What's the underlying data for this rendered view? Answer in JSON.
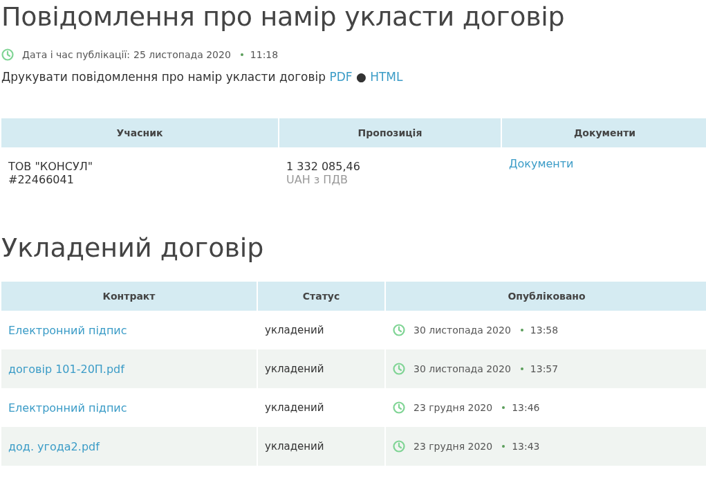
{
  "title": "Повідомлення про намір укласти договір",
  "publication": {
    "label": "Дата і час публікації:",
    "date": "25 листопада 2020",
    "time": "11:18"
  },
  "print": {
    "text": "Друкувати повідомлення про намір укласти договір",
    "links": [
      "PDF",
      "HTML"
    ],
    "separator": "●"
  },
  "offers_table": {
    "columns": [
      "Учасник",
      "Пропозиція",
      "Документи"
    ],
    "rows": [
      {
        "participant": "ТОВ \"КОНСУЛ\"",
        "participant_id": "#22466041",
        "amount": "1 332 085,46",
        "currency": "UAH з ПДВ",
        "documents": "Документи"
      }
    ]
  },
  "contract_heading": "Укладений договір",
  "contracts_table": {
    "columns": [
      "Контракт",
      "Статус",
      "Опубліковано"
    ],
    "rows": [
      {
        "contract": "Електронний підпис",
        "status": "укладений",
        "date": "30 листопада 2020",
        "time": "13:58"
      },
      {
        "contract": "договір 101-20П.pdf",
        "status": "укладений",
        "date": "30 листопада 2020",
        "time": "13:57"
      },
      {
        "contract": "Електронний підпис",
        "status": "укладений",
        "date": "23 грудня 2020",
        "time": "13:46"
      },
      {
        "contract": "дод. угода2.pdf",
        "status": "укладений",
        "date": "23 грудня 2020",
        "time": "13:43"
      }
    ]
  }
}
